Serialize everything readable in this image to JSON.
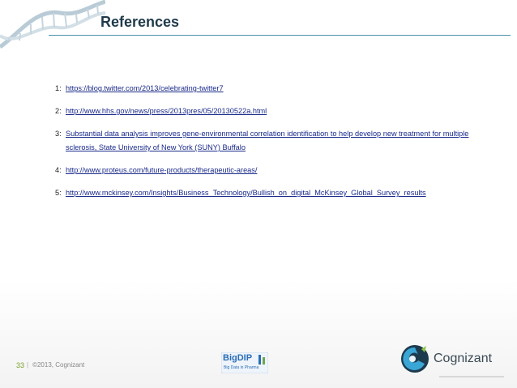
{
  "slide": {
    "title": "References",
    "references": [
      {
        "num": "1:",
        "text": "https://blog.twitter.com/2013/celebrating-twitter7"
      },
      {
        "num": "2:",
        "text": "http://www.hhs.gov/news/press/2013pres/05/20130522a.html"
      },
      {
        "num": "3:",
        "text": "Substantial data analysis improves gene-environmental correlation identification to help develop new treatment for multiple sclerosis, State University of New York (SUNY) Buffalo"
      },
      {
        "num": "4:",
        "text": "http://www.proteus.com/future-products/therapeutic-areas/"
      },
      {
        "num": "5:",
        "text": "http://www.mckinsey.com/Insights/Business_Technology/Bullish_on_digital_McKinsey_Global_Survey_results"
      }
    ]
  },
  "footer": {
    "page_number": "33",
    "separator": "|",
    "copyright": "©2013, Cognizant",
    "bigdip_name": "BigDIP",
    "bigdip_tagline": "Big Data in Pharma",
    "company": "Cognizant"
  },
  "icons": {
    "decoration": "dna-helix-icon",
    "logo": "cognizant-logo-icon"
  },
  "colors": {
    "title": "#1f3a4a",
    "rule": "#4a90a8",
    "link": "#1a2a8a",
    "page_number": "#7aa12e",
    "bigdip": "#2a6db5"
  }
}
